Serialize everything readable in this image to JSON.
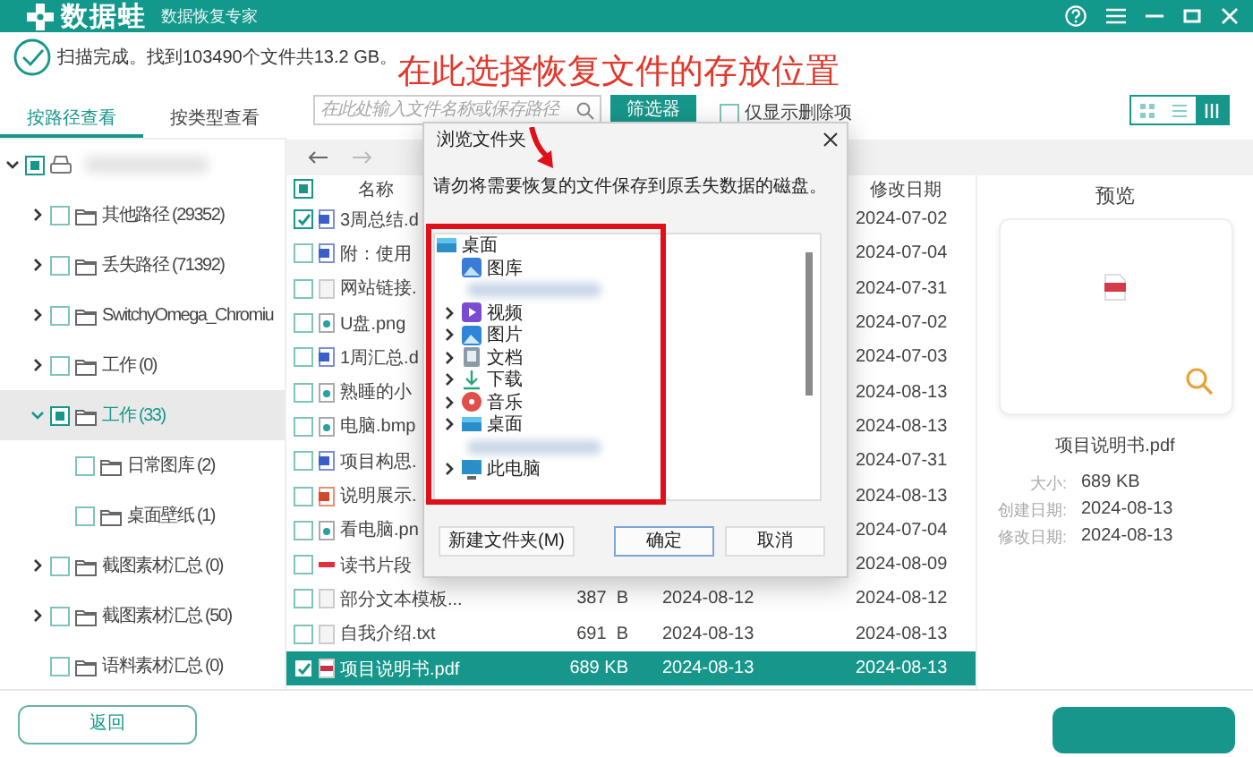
{
  "title_bar": {
    "app_name": "数据蛙",
    "subtitle": "数据恢复专家"
  },
  "status": {
    "text": "扫描完成。找到103490个文件共13.2 GB。"
  },
  "annotation": {
    "text": "在此选择恢复文件的存放位置"
  },
  "tabs": [
    {
      "label": "按路径查看",
      "selected": true
    },
    {
      "label": "按类型查看",
      "selected": false
    }
  ],
  "search": {
    "placeholder": "在此处输入文件名称或保存路径"
  },
  "filter_button": "筛选器",
  "deleted_only": {
    "label": "仅显示删除项",
    "checked": false
  },
  "view_modes": [
    {
      "kind": "grid",
      "selected": false
    },
    {
      "kind": "list",
      "selected": false
    },
    {
      "kind": "detail",
      "selected": true
    }
  ],
  "folder_tree": {
    "items": [
      {
        "kind": "drive",
        "expanded": true,
        "checked": true,
        "mixed": true,
        "selected": false,
        "children": [
          {
            "label": "其他路径 (29352)",
            "expanded": false,
            "checked": false,
            "mixed": false,
            "selected": false
          },
          {
            "label": "丢失路径 (71392)",
            "expanded": false,
            "checked": false,
            "mixed": false,
            "selected": false
          },
          {
            "label": "SwitchyOmega_Chromiu",
            "expanded": false,
            "checked": false,
            "mixed": false,
            "selected": false
          },
          {
            "label": "工作 (0)",
            "expanded": false,
            "checked": false,
            "mixed": false,
            "selected": false
          },
          {
            "label": "工作 (33)",
            "expanded": true,
            "checked": true,
            "mixed": true,
            "selected": true,
            "children": [
              {
                "label": "日常图库 (2)",
                "checked": false,
                "mixed": false,
                "selected": false
              },
              {
                "label": "桌面壁纸 (1)",
                "checked": false,
                "mixed": false,
                "selected": false
              }
            ]
          },
          {
            "label": "截图素材汇总 (0)",
            "expanded": false,
            "checked": false,
            "mixed": false,
            "selected": false
          },
          {
            "label": "截图素材汇总 (50)",
            "expanded": false,
            "checked": false,
            "mixed": false,
            "selected": false
          },
          {
            "label": "语料素材汇总 (0)",
            "checked": false,
            "mixed": false,
            "selected": false
          }
        ]
      }
    ]
  },
  "file_list": {
    "header_checkbox": {
      "checked": true,
      "mixed": true
    },
    "columns": [
      {
        "kind": "name",
        "label": "名称"
      },
      {
        "kind": "modified",
        "label": "修改日期"
      }
    ],
    "rows": [
      {
        "name": "3周总结.d",
        "kind": "doc",
        "modified": "2024-07-02",
        "checked": true,
        "selected": false
      },
      {
        "name": "附：使用",
        "kind": "doc",
        "modified": "2024-07-04",
        "checked": false,
        "selected": false
      },
      {
        "name": "网站链接.",
        "kind": "txt",
        "modified": "2024-07-31",
        "checked": false,
        "selected": false
      },
      {
        "name": "U盘.png",
        "kind": "img",
        "modified": "2024-07-02",
        "checked": false,
        "selected": false
      },
      {
        "name": "1周汇总.d",
        "kind": "doc",
        "modified": "2024-07-03",
        "checked": false,
        "selected": false
      },
      {
        "name": "熟睡的小",
        "kind": "img",
        "modified": "2024-08-13",
        "checked": false,
        "selected": false
      },
      {
        "name": "电脑.bmp",
        "kind": "img",
        "modified": "2024-08-13",
        "checked": false,
        "selected": false
      },
      {
        "name": "项目构思.",
        "kind": "doc",
        "modified": "2024-07-31",
        "checked": false,
        "selected": false
      },
      {
        "name": "说明展示.",
        "kind": "ppt",
        "modified": "2024-08-13",
        "checked": false,
        "selected": false
      },
      {
        "name": "看电脑.pn",
        "kind": "img",
        "modified": "2024-07-04",
        "checked": false,
        "selected": false
      },
      {
        "name": "读书片段",
        "kind": "note",
        "modified": "2024-08-09",
        "checked": false,
        "selected": false
      },
      {
        "name": "部分文本模板...",
        "kind": "txt",
        "size": "387  B",
        "created": "2024-08-12",
        "modified": "2024-08-12",
        "checked": false,
        "selected": false
      },
      {
        "name": "自我介绍.txt",
        "kind": "txt",
        "size": "691  B",
        "created": "2024-08-13",
        "modified": "2024-08-13",
        "checked": false,
        "selected": false
      },
      {
        "name": "项目说明书.pdf",
        "kind": "pdf",
        "size": "689 KB",
        "created": "2024-08-13",
        "modified": "2024-08-13",
        "checked": true,
        "selected": true
      }
    ]
  },
  "preview": {
    "title": "预览",
    "file_name": "项目说明书.pdf",
    "info": [
      {
        "label": "大小:",
        "value": "689 KB"
      },
      {
        "label": "创建日期:",
        "value": "2024-08-13"
      },
      {
        "label": "修改日期:",
        "value": "2024-08-13"
      }
    ]
  },
  "footer": {
    "back_button": "返回"
  },
  "dialog": {
    "title": "浏览文件夹",
    "message": "请勿将需要恢复的文件保存到原丢失数据的磁盘。",
    "items": [
      {
        "label": "桌面",
        "kind": "desktop",
        "children": [
          {
            "label": "图库",
            "kind": "gallery"
          },
          {
            "kind": "blurred"
          },
          {
            "label": "视频",
            "kind": "video",
            "expanded": false
          },
          {
            "label": "图片",
            "kind": "pictures",
            "expanded": false
          },
          {
            "label": "文档",
            "kind": "documents",
            "expanded": false
          },
          {
            "label": "下载",
            "kind": "downloads",
            "expanded": false
          },
          {
            "label": "音乐",
            "kind": "music",
            "expanded": false
          },
          {
            "label": "桌面",
            "kind": "desktop",
            "expanded": false
          },
          {
            "kind": "blurred"
          },
          {
            "label": "此电脑",
            "kind": "pc",
            "expanded": false
          }
        ]
      }
    ],
    "buttons": [
      {
        "label": "新建文件夹(M)",
        "default": false
      },
      {
        "label": "确定",
        "default": true
      },
      {
        "label": "取消",
        "default": false
      }
    ]
  }
}
